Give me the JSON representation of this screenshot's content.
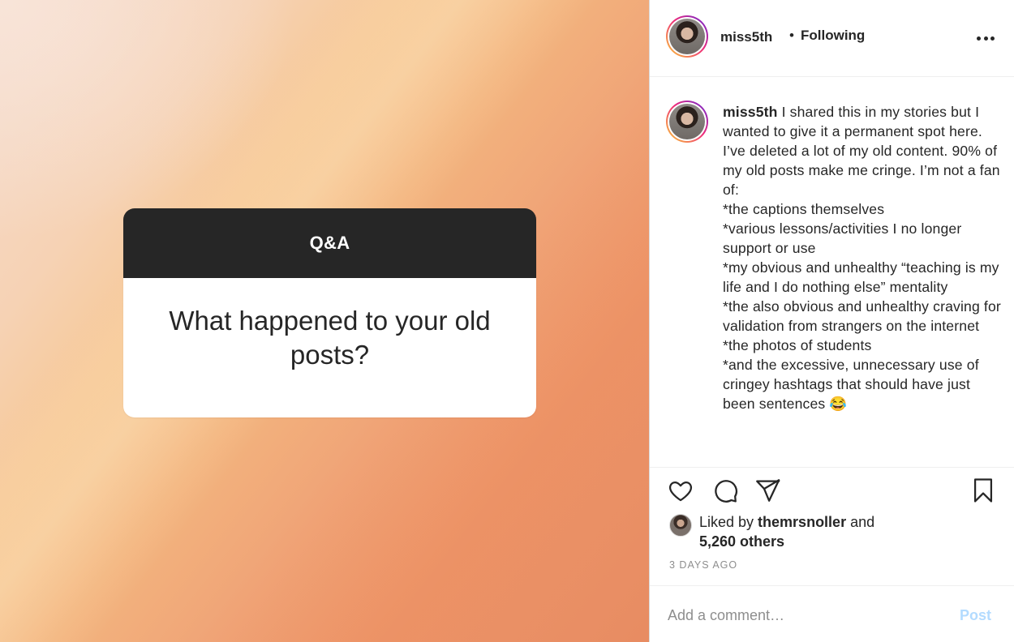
{
  "post_media": {
    "qa_card": {
      "header": "Q&A",
      "question": "What happened to your old posts?"
    }
  },
  "header": {
    "username": "miss5th",
    "separator": "•",
    "follow_status": "Following"
  },
  "caption": {
    "username": "miss5th",
    "text": " I shared this in my stories but I wanted to give it a permanent spot here. I’ve deleted a lot of my old content. 90% of my old posts make me cringe. I’m not a fan of:\n*the captions themselves\n*various lessons/activities I no longer support or use\n*my obvious and unhealthy “teaching is my life and I do nothing else” mentality\n*the also obvious and unhealthy craving for validation from strangers on the internet\n*the photos of students\n*and the excessive, unnecessary use of cringey hashtags that should have just been sentences 😂"
  },
  "likes": {
    "prefix": "Liked by ",
    "liker": "themrsnoller",
    "and": " and",
    "others": "5,260 others"
  },
  "timestamp": "3 DAYS AGO",
  "comment": {
    "placeholder": "Add a comment…",
    "post_label": "Post"
  },
  "icons": {
    "more": "more-options-icon",
    "like": "heart-icon",
    "comment": "comment-bubble-icon",
    "share": "paper-plane-icon",
    "save": "bookmark-icon"
  },
  "colors": {
    "text": "#262626",
    "secondary": "#8e8e8e",
    "post_button_disabled": "#b3dbff",
    "qa_header_bg": "#262626"
  }
}
